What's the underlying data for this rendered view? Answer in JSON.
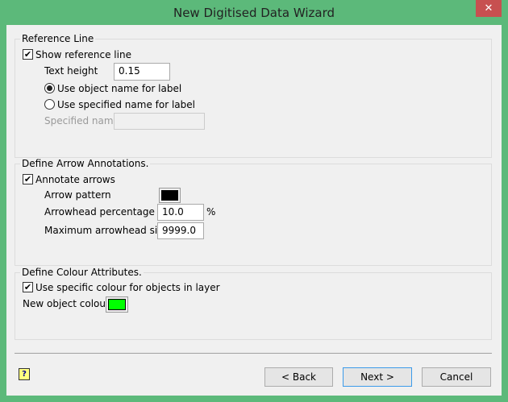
{
  "window": {
    "title": "New Digitised Data Wizard",
    "close_label": "✕"
  },
  "reference_line": {
    "legend": "Reference Line",
    "show_label": "Show reference line",
    "show_checked": true,
    "text_height_label": "Text height",
    "text_height_value": "0.15",
    "radio_object_label": "Use object name for label",
    "radio_specified_label": "Use specified name for label",
    "selected": "object",
    "specified_name_label": "Specified name",
    "specified_name_value": ""
  },
  "arrows": {
    "legend": "Define Arrow Annotations.",
    "annotate_label": "Annotate arrows",
    "annotate_checked": true,
    "pattern_label": "Arrow pattern",
    "pattern_color": "#000000",
    "percentage_label": "Arrowhead percentage",
    "percentage_value": "10.0",
    "percent_unit": "%",
    "max_size_label": "Maximum arrowhead size",
    "max_size_value": "9999.0"
  },
  "colour": {
    "legend": "Define Colour Attributes.",
    "specific_label": "Use specific colour for objects in layer",
    "specific_checked": true,
    "new_colour_label": "New object colour",
    "new_colour": "#00ff00"
  },
  "footer": {
    "help_icon": "?",
    "back_label": "< Back",
    "next_label": "Next >",
    "cancel_label": "Cancel"
  },
  "theme": {
    "frame": "#5cb97a",
    "close": "#c75050"
  }
}
